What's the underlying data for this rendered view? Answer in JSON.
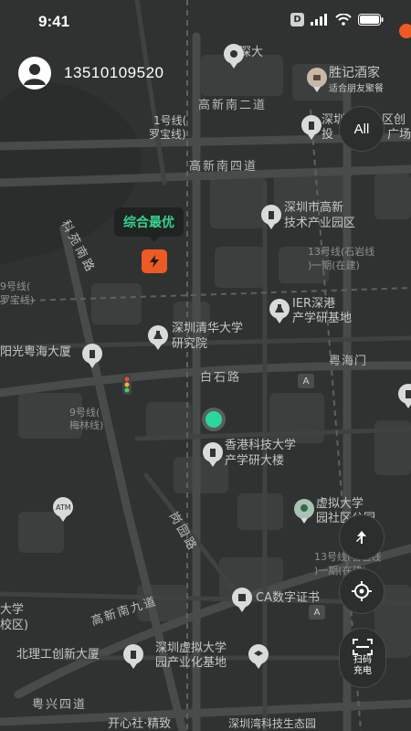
{
  "status_bar": {
    "time": "9:41",
    "badge": "D"
  },
  "user": {
    "phone": "13510109520"
  },
  "controls": {
    "all_label": "All",
    "scan_label_1": "扫码",
    "scan_label_2": "充电"
  },
  "tooltip": {
    "text": "综合最优"
  },
  "map": {
    "roads": [
      {
        "id": "gaoxin-nan-2",
        "text": "高新南二道"
      },
      {
        "id": "gaoxin-nan-4",
        "text": "高新南四道"
      },
      {
        "id": "baishi",
        "text": "白石路"
      },
      {
        "id": "gaoxin-nan-9",
        "text": "高新南九道"
      },
      {
        "id": "yuexing-4",
        "text": "粤兴四道"
      },
      {
        "id": "keyuan",
        "text": "科苑南路"
      },
      {
        "id": "gangyuan",
        "text": "岗园路"
      },
      {
        "id": "yuehai",
        "text": "粤海门"
      }
    ],
    "places": [
      {
        "id": "shenda",
        "text": "深大"
      },
      {
        "id": "shengji-1",
        "text": "胜记酒家"
      },
      {
        "id": "shengji-2",
        "text": "适合朋友聚餐"
      },
      {
        "id": "line1-1",
        "text": "1号线("
      },
      {
        "id": "line1-2",
        "text": "罗宝线)"
      },
      {
        "id": "sz-bldg-1",
        "text": "深圳"
      },
      {
        "id": "sz-bldg-2",
        "text": "投"
      },
      {
        "id": "right-edge-1",
        "text": "区创"
      },
      {
        "id": "right-edge-2",
        "text": "广场"
      },
      {
        "id": "hitech-park-1",
        "text": "深圳市高新"
      },
      {
        "id": "hitech-park-2",
        "text": "技术产业园区"
      },
      {
        "id": "line13-1",
        "text": "13号线(石岩线"
      },
      {
        "id": "line13-2",
        "text": ")一期(在建)"
      },
      {
        "id": "line9-left-1",
        "text": "9号线("
      },
      {
        "id": "line9-left-2",
        "text": "罗宝线)"
      },
      {
        "id": "ier-1",
        "text": "IER深港"
      },
      {
        "id": "ier-2",
        "text": "产学研基地"
      },
      {
        "id": "tsinghua-1",
        "text": "深圳清华大学"
      },
      {
        "id": "tsinghua-2",
        "text": "研究院"
      },
      {
        "id": "yangguang",
        "text": "阳光粤海大厦"
      },
      {
        "id": "line9-1",
        "text": "9号线("
      },
      {
        "id": "line9-2",
        "text": "梅林线)"
      },
      {
        "id": "hkust-1",
        "text": "香港科技大学"
      },
      {
        "id": "hkust-2",
        "text": "产学研大楼"
      },
      {
        "id": "atm",
        "text": "ATM"
      },
      {
        "id": "virtual-1",
        "text": "虚拟大学"
      },
      {
        "id": "virtual-2",
        "text": "园社区公园"
      },
      {
        "id": "line13b-1",
        "text": "13号线(石岩线"
      },
      {
        "id": "line13b-2",
        "text": ")一期(在建)"
      },
      {
        "id": "ca-book",
        "text": "CA数字证书"
      },
      {
        "id": "left-school-1",
        "text": "大学"
      },
      {
        "id": "left-school-2",
        "text": "校区)"
      },
      {
        "id": "beili",
        "text": "北理工创新大厦"
      },
      {
        "id": "virtual-park-1",
        "text": "深圳虚拟大学"
      },
      {
        "id": "virtual-park-2",
        "text": "园产业化基地"
      },
      {
        "id": "bottom",
        "text": "开心社·精致"
      },
      {
        "id": "bottom-right",
        "text": "深圳湾科技生态园"
      }
    ]
  }
}
